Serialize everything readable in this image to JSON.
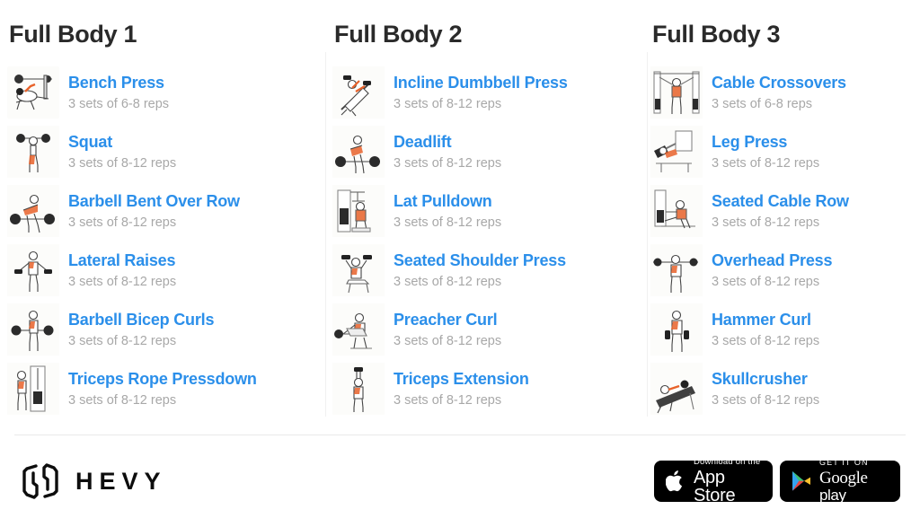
{
  "columns": [
    {
      "title": "Full Body 1",
      "exercises": [
        {
          "name": "Bench Press",
          "sets": "3 sets of 6-8 reps",
          "icon": "bench-press-icon"
        },
        {
          "name": "Squat",
          "sets": "3 sets of 8-12 reps",
          "icon": "squat-icon"
        },
        {
          "name": "Barbell Bent Over Row",
          "sets": "3 sets of 8-12 reps",
          "icon": "barbell-row-icon"
        },
        {
          "name": "Lateral Raises",
          "sets": "3 sets of 8-12 reps",
          "icon": "lateral-raise-icon"
        },
        {
          "name": "Barbell Bicep Curls",
          "sets": "3 sets of 8-12 reps",
          "icon": "barbell-curl-icon"
        },
        {
          "name": "Triceps Rope Pressdown",
          "sets": "3 sets of 8-12 reps",
          "icon": "rope-pressdown-icon"
        }
      ]
    },
    {
      "title": "Full Body 2",
      "exercises": [
        {
          "name": "Incline Dumbbell Press",
          "sets": "3 sets of 8-12 reps",
          "icon": "incline-dumbbell-press-icon"
        },
        {
          "name": "Deadlift",
          "sets": "3 sets of 8-12 reps",
          "icon": "deadlift-icon"
        },
        {
          "name": "Lat Pulldown",
          "sets": "3 sets of 8-12 reps",
          "icon": "lat-pulldown-icon"
        },
        {
          "name": "Seated Shoulder Press",
          "sets": "3 sets of 8-12 reps",
          "icon": "seated-shoulder-press-icon"
        },
        {
          "name": "Preacher Curl",
          "sets": "3 sets of 8-12 reps",
          "icon": "preacher-curl-icon"
        },
        {
          "name": "Triceps Extension",
          "sets": "3 sets of 8-12 reps",
          "icon": "triceps-extension-icon"
        }
      ]
    },
    {
      "title": "Full Body 3",
      "exercises": [
        {
          "name": "Cable Crossovers",
          "sets": "3 sets of 6-8 reps",
          "icon": "cable-crossover-icon"
        },
        {
          "name": "Leg Press",
          "sets": "3 sets of 8-12 reps",
          "icon": "leg-press-icon"
        },
        {
          "name": "Seated Cable Row",
          "sets": "3 sets of 8-12 reps",
          "icon": "seated-cable-row-icon"
        },
        {
          "name": "Overhead Press",
          "sets": "3 sets of 8-12 reps",
          "icon": "overhead-press-icon"
        },
        {
          "name": "Hammer Curl",
          "sets": "3 sets of 8-12 reps",
          "icon": "hammer-curl-icon"
        },
        {
          "name": "Skullcrusher",
          "sets": "3 sets of 8-12 reps",
          "icon": "skullcrusher-icon"
        }
      ]
    }
  ],
  "footer": {
    "brand_name": "HEVY",
    "brand_mark": "hevy-logo-icon",
    "app_store": {
      "small": "Download on the",
      "big": "App Store",
      "icon": "apple-icon"
    },
    "google_play": {
      "small": "GET IT ON",
      "big_bold": "Google",
      "big_light": "play",
      "icon": "google-play-icon"
    }
  },
  "colors": {
    "exercise_name": "#2b8fea",
    "sets_text": "#a8a8a8",
    "heading": "#2a2a2a",
    "badge_bg": "#000000",
    "muscle_highlight": "#e8622a",
    "page_bg": "#ffffff"
  }
}
